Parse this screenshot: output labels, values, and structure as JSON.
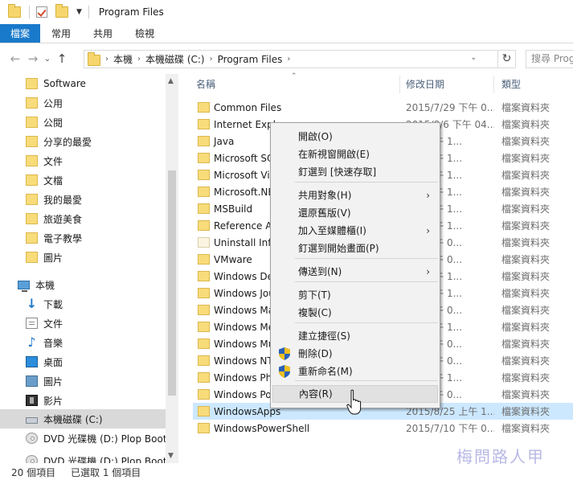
{
  "titlebar": {
    "title": "Program Files"
  },
  "ribbon": {
    "tabs": [
      "檔案",
      "常用",
      "共用",
      "檢視"
    ]
  },
  "address": {
    "crumbs": [
      "本機",
      "本機磁碟 (C:)",
      "Program Files"
    ],
    "search_placeholder": "搜尋 Prog"
  },
  "navpane": {
    "items": [
      {
        "label": "Software",
        "icon": "folder-icon"
      },
      {
        "label": "公用",
        "icon": "folder-icon"
      },
      {
        "label": "公閱",
        "icon": "folder-icon"
      },
      {
        "label": "分享的最愛",
        "icon": "folder-icon"
      },
      {
        "label": "文件",
        "icon": "folder-icon"
      },
      {
        "label": "文檔",
        "icon": "folder-icon"
      },
      {
        "label": "我的最愛",
        "icon": "folder-icon"
      },
      {
        "label": "旅遊美食",
        "icon": "folder-icon"
      },
      {
        "label": "電子教學",
        "icon": "folder-icon"
      },
      {
        "label": "圖片",
        "icon": "folder-icon"
      },
      {
        "label": "本機",
        "icon": "pc-icon"
      },
      {
        "label": "下載",
        "icon": "download-icon"
      },
      {
        "label": "文件",
        "icon": "documents-icon"
      },
      {
        "label": "音樂",
        "icon": "music-icon"
      },
      {
        "label": "桌面",
        "icon": "desktop-icon"
      },
      {
        "label": "圖片",
        "icon": "pictures-icon"
      },
      {
        "label": "影片",
        "icon": "videos-icon"
      },
      {
        "label": "本機磁碟 (C:)",
        "icon": "drive-icon"
      },
      {
        "label": "DVD 光碟機 (D:) Plop Boot M",
        "icon": "dvd-icon"
      },
      {
        "label": "DVD 光碟機 (D:) Plop Boot M",
        "icon": "dvd-icon"
      }
    ]
  },
  "filelist": {
    "columns": [
      "名稱",
      "修改日期",
      "類型"
    ],
    "rows": [
      {
        "name": "Common Files",
        "date": "2015/7/29 下午 0...",
        "type": "檔案資料夾"
      },
      {
        "name": "Internet Expl",
        "date": "2015/8/6 下午 04...",
        "type": "檔案資料夾"
      },
      {
        "name": "Java",
        "date": "/25 上午 1...",
        "type": "檔案資料夾"
      },
      {
        "name": "Microsoft SQ",
        "date": "/25 上午 1...",
        "type": "檔案資料夾"
      },
      {
        "name": "Microsoft Vis",
        "date": "/25 上午 1...",
        "type": "檔案資料夾"
      },
      {
        "name": "Microsoft.NE",
        "date": "/25 上午 1...",
        "type": "檔案資料夾"
      },
      {
        "name": "MSBuild",
        "date": "/25 上午 1...",
        "type": "檔案資料夾"
      },
      {
        "name": "Reference As",
        "date": "/25 上午 1...",
        "type": "檔案資料夾"
      },
      {
        "name": "Uninstall Info",
        "date": "/10 下午 0...",
        "type": "檔案資料夾"
      },
      {
        "name": "VMware",
        "date": "/29 下午 0...",
        "type": "檔案資料夾"
      },
      {
        "name": "Windows De",
        "date": "/11 上午 1...",
        "type": "檔案資料夾"
      },
      {
        "name": "Windows Jou",
        "date": "/25 上午 1...",
        "type": "檔案資料夾"
      },
      {
        "name": "Windows Ma",
        "date": "/10 下午 0...",
        "type": "檔案資料夾"
      },
      {
        "name": "Windows Me",
        "date": "/25 上午 1...",
        "type": "檔案資料夾"
      },
      {
        "name": "Windows Mu",
        "date": "/10 下午 0...",
        "type": "檔案資料夾"
      },
      {
        "name": "Windows NT",
        "date": "/10 下午 0...",
        "type": "檔案資料夾"
      },
      {
        "name": "Windows Pho",
        "date": "/25 上午 1...",
        "type": "檔案資料夾"
      },
      {
        "name": "Windows Po",
        "date": "/10 下午 0...",
        "type": "檔案資料夾"
      },
      {
        "name": "WindowsApps",
        "date": "2015/8/25 上午 1...",
        "type": "檔案資料夾"
      },
      {
        "name": "WindowsPowerShell",
        "date": "2015/7/10 下午 0...",
        "type": "檔案資料夾"
      }
    ]
  },
  "context_menu": {
    "items": [
      "開啟(O)",
      "在新視窗開啟(E)",
      "釘選到 [快速存取]",
      "共用對象(H)",
      "還原舊版(V)",
      "加入至媒體櫃(I)",
      "釘選到開始畫面(P)",
      "傳送到(N)",
      "剪下(T)",
      "複製(C)",
      "建立捷徑(S)",
      "刪除(D)",
      "重新命名(M)",
      "內容(R)"
    ]
  },
  "status": {
    "count": "20 個項目",
    "selected": "已選取 1 個項目"
  },
  "watermark": "梅問路人甲",
  "colors": {
    "file_tab": "#1979ca",
    "selected_row": "#cce8ff",
    "header_text": "#4c607a"
  }
}
